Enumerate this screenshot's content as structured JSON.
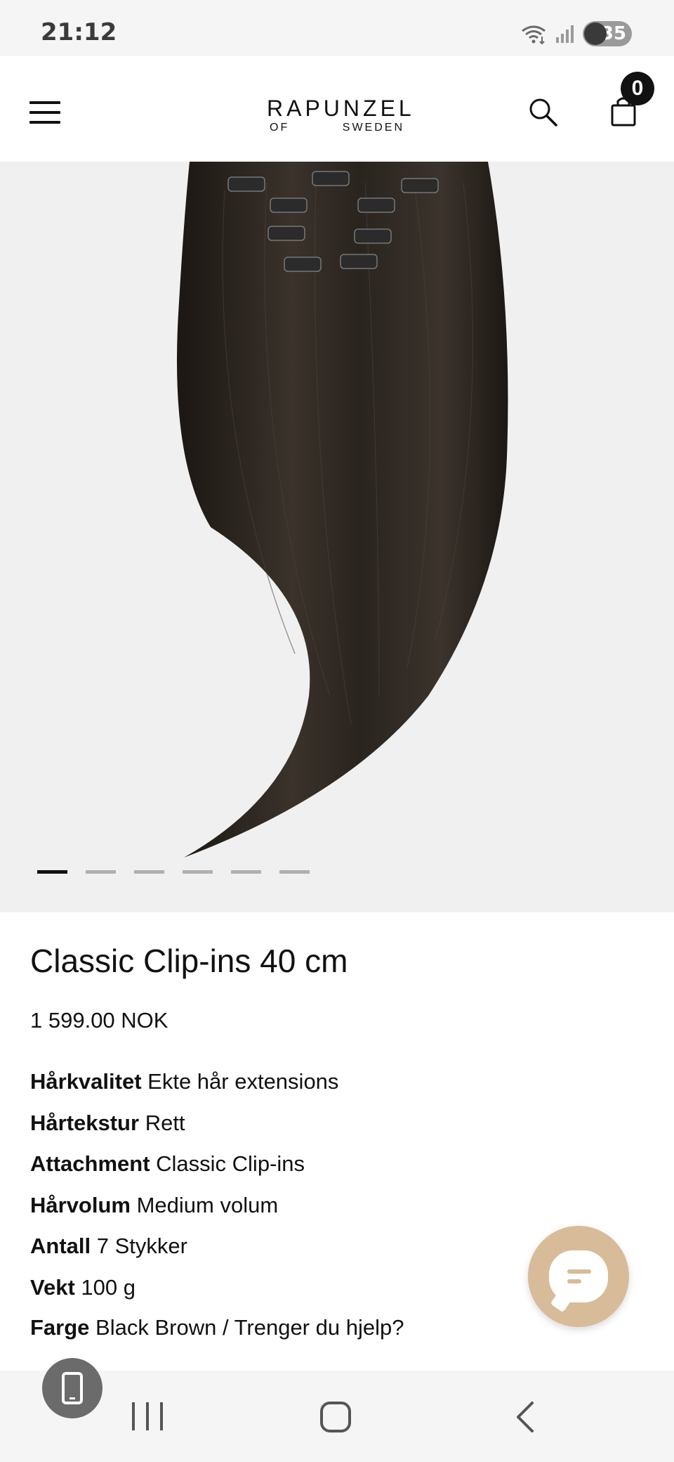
{
  "status_bar": {
    "time": "21:12",
    "battery_level": "35",
    "icons": [
      "wifi-icon",
      "signal-icon",
      "battery-icon"
    ]
  },
  "header": {
    "menu_icon": "hamburger-menu-icon",
    "logo_main": "RAPUNZEL",
    "logo_sub_left": "OF",
    "logo_sub_right": "SWEDEN",
    "search_icon": "search-icon",
    "cart_icon": "shopping-bag-icon",
    "cart_count": "0"
  },
  "gallery": {
    "image_subject": "black brown straight clip-in hair extensions",
    "total_slides": 6,
    "active_slide": 1
  },
  "product": {
    "title": "Classic Clip-ins 40 cm",
    "price": "1 599.00 NOK",
    "specs": [
      {
        "key": "Hårkvalitet",
        "value": "Ekte hår extensions"
      },
      {
        "key": "Hårtekstur",
        "value": "Rett"
      },
      {
        "key": "Attachment",
        "value": "Classic Clip-ins"
      },
      {
        "key": "Hårvolum",
        "value": "Medium volum"
      },
      {
        "key": "Antall",
        "value": "7 Stykker"
      },
      {
        "key": "Vekt",
        "value": "100 g"
      }
    ],
    "color_key": "Farge",
    "color_value": "Black Brown / Trenger du hjelp?"
  },
  "chat": {
    "icon": "chat-bubble-icon",
    "color": "#d8bb98"
  },
  "nav": {
    "recent_icon": "recent-apps-icon",
    "home_icon": "home-icon",
    "back_icon": "back-icon",
    "floating_icon": "phone-icon"
  }
}
